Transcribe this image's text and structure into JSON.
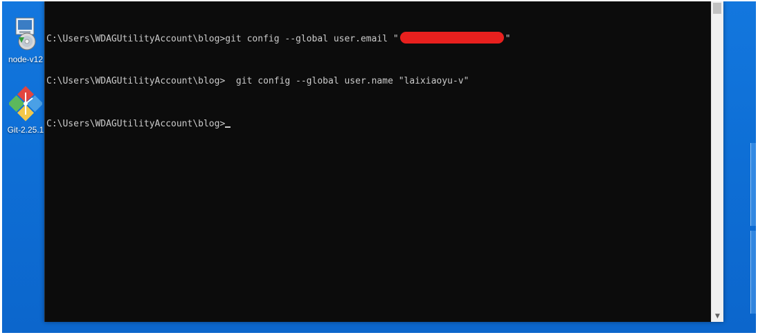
{
  "desktop": {
    "icons": [
      {
        "label": "node-v12",
        "icon": "installer-disc-icon"
      },
      {
        "label": "Git-2.25.1",
        "icon": "git-diamond-icon"
      }
    ]
  },
  "terminal": {
    "lines": [
      {
        "prompt": "C:\\Users\\WDAGUtilityAccount\\blog>",
        "command_before": "git config --global user.email \"",
        "redacted": true,
        "command_after": "\""
      },
      {
        "prompt": "C:\\Users\\WDAGUtilityAccount\\blog>",
        "command": "  git config --global user.name \"laixiaoyu-v\""
      },
      {
        "prompt": "C:\\Users\\WDAGUtilityAccount\\blog>",
        "command": ""
      }
    ],
    "colors": {
      "background": "#0c0c0c",
      "text": "#cccccc",
      "redaction": "#e8201e"
    }
  },
  "scrollbar": {
    "up_arrow": "▲",
    "down_arrow": "▼"
  }
}
